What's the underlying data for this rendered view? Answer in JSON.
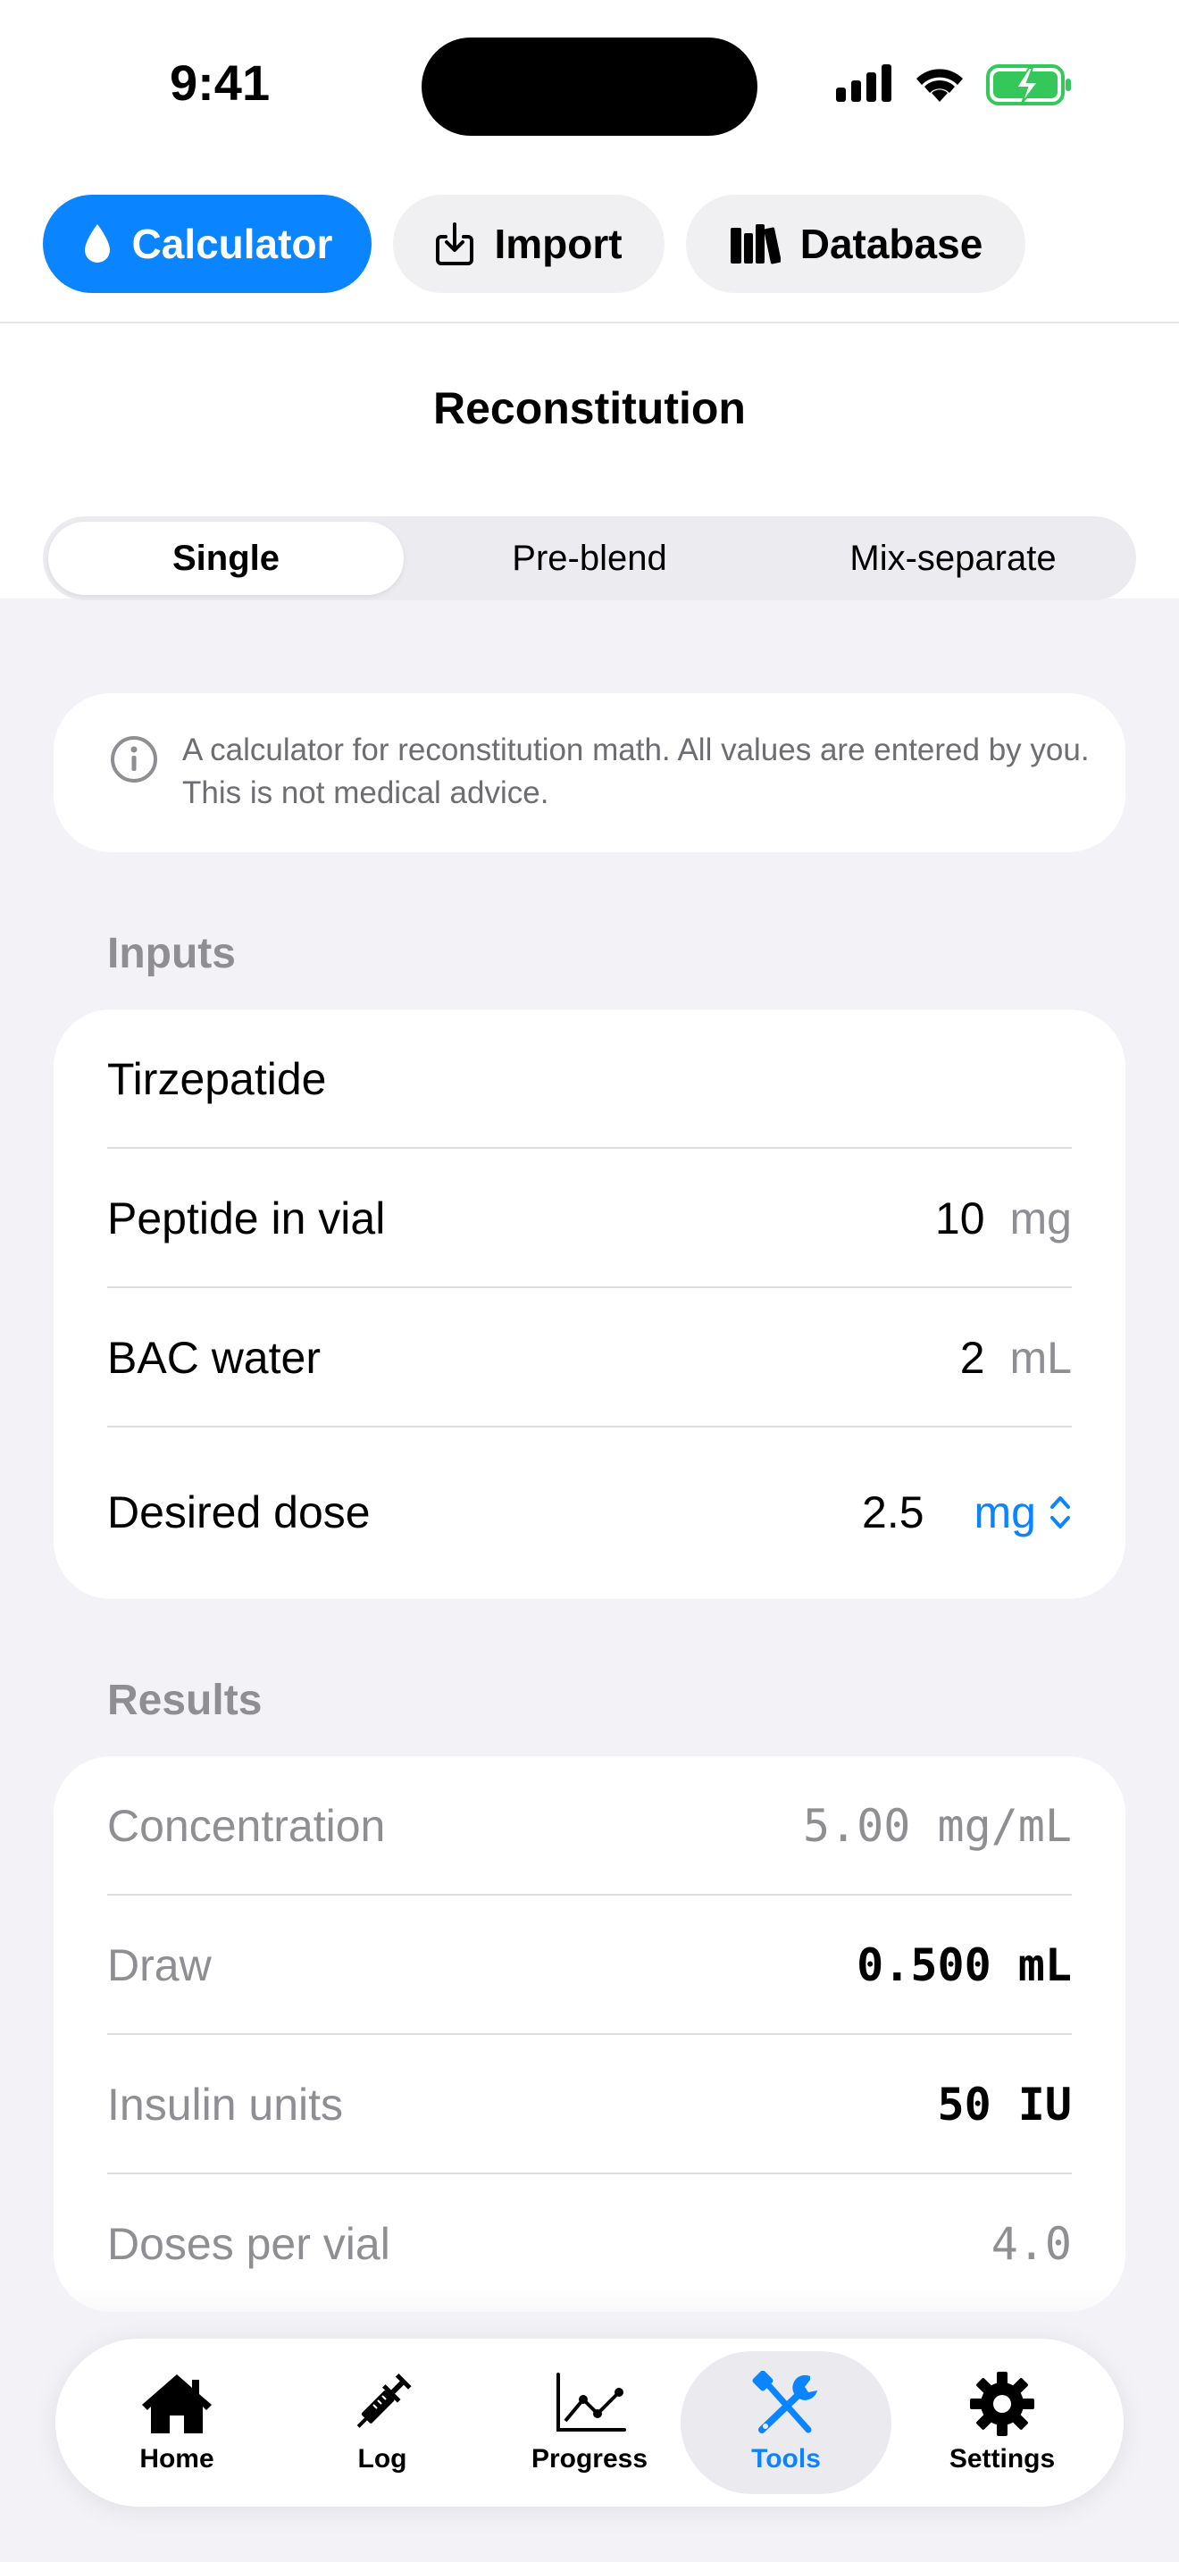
{
  "status_bar": {
    "time": "9:41"
  },
  "top_nav": {
    "calculator": "Calculator",
    "import": "Import",
    "database": "Database"
  },
  "page_title": "Reconstitution",
  "segments": {
    "single": "Single",
    "pre_blend": "Pre-blend",
    "mix_separate": "Mix-separate",
    "selected": "Single"
  },
  "info_text": "A calculator for reconstitution math. All values are entered by you. This is not medical advice.",
  "inputs": {
    "section_label": "Inputs",
    "peptide_name": "Tirzepatide",
    "peptide_in_vial_label": "Peptide in vial",
    "peptide_in_vial_value": "10",
    "peptide_in_vial_unit": "mg",
    "bac_water_label": "BAC water",
    "bac_water_value": "2",
    "bac_water_unit": "mL",
    "desired_dose_label": "Desired dose",
    "desired_dose_value": "2.5",
    "desired_dose_unit": "mg"
  },
  "results": {
    "section_label": "Results",
    "concentration_label": "Concentration",
    "concentration_value": "5.00 mg/mL",
    "draw_label": "Draw",
    "draw_value": "0.500 mL",
    "insulin_units_label": "Insulin units",
    "insulin_units_value": "50 IU",
    "doses_per_vial_label": "Doses per vial",
    "doses_per_vial_value": "4.0"
  },
  "tab_bar": {
    "home": "Home",
    "log": "Log",
    "progress": "Progress",
    "tools": "Tools",
    "settings": "Settings",
    "active": "Tools"
  },
  "colors": {
    "accent": "#0a84ff",
    "background": "#f2f2f7",
    "battery": "#34c759"
  }
}
